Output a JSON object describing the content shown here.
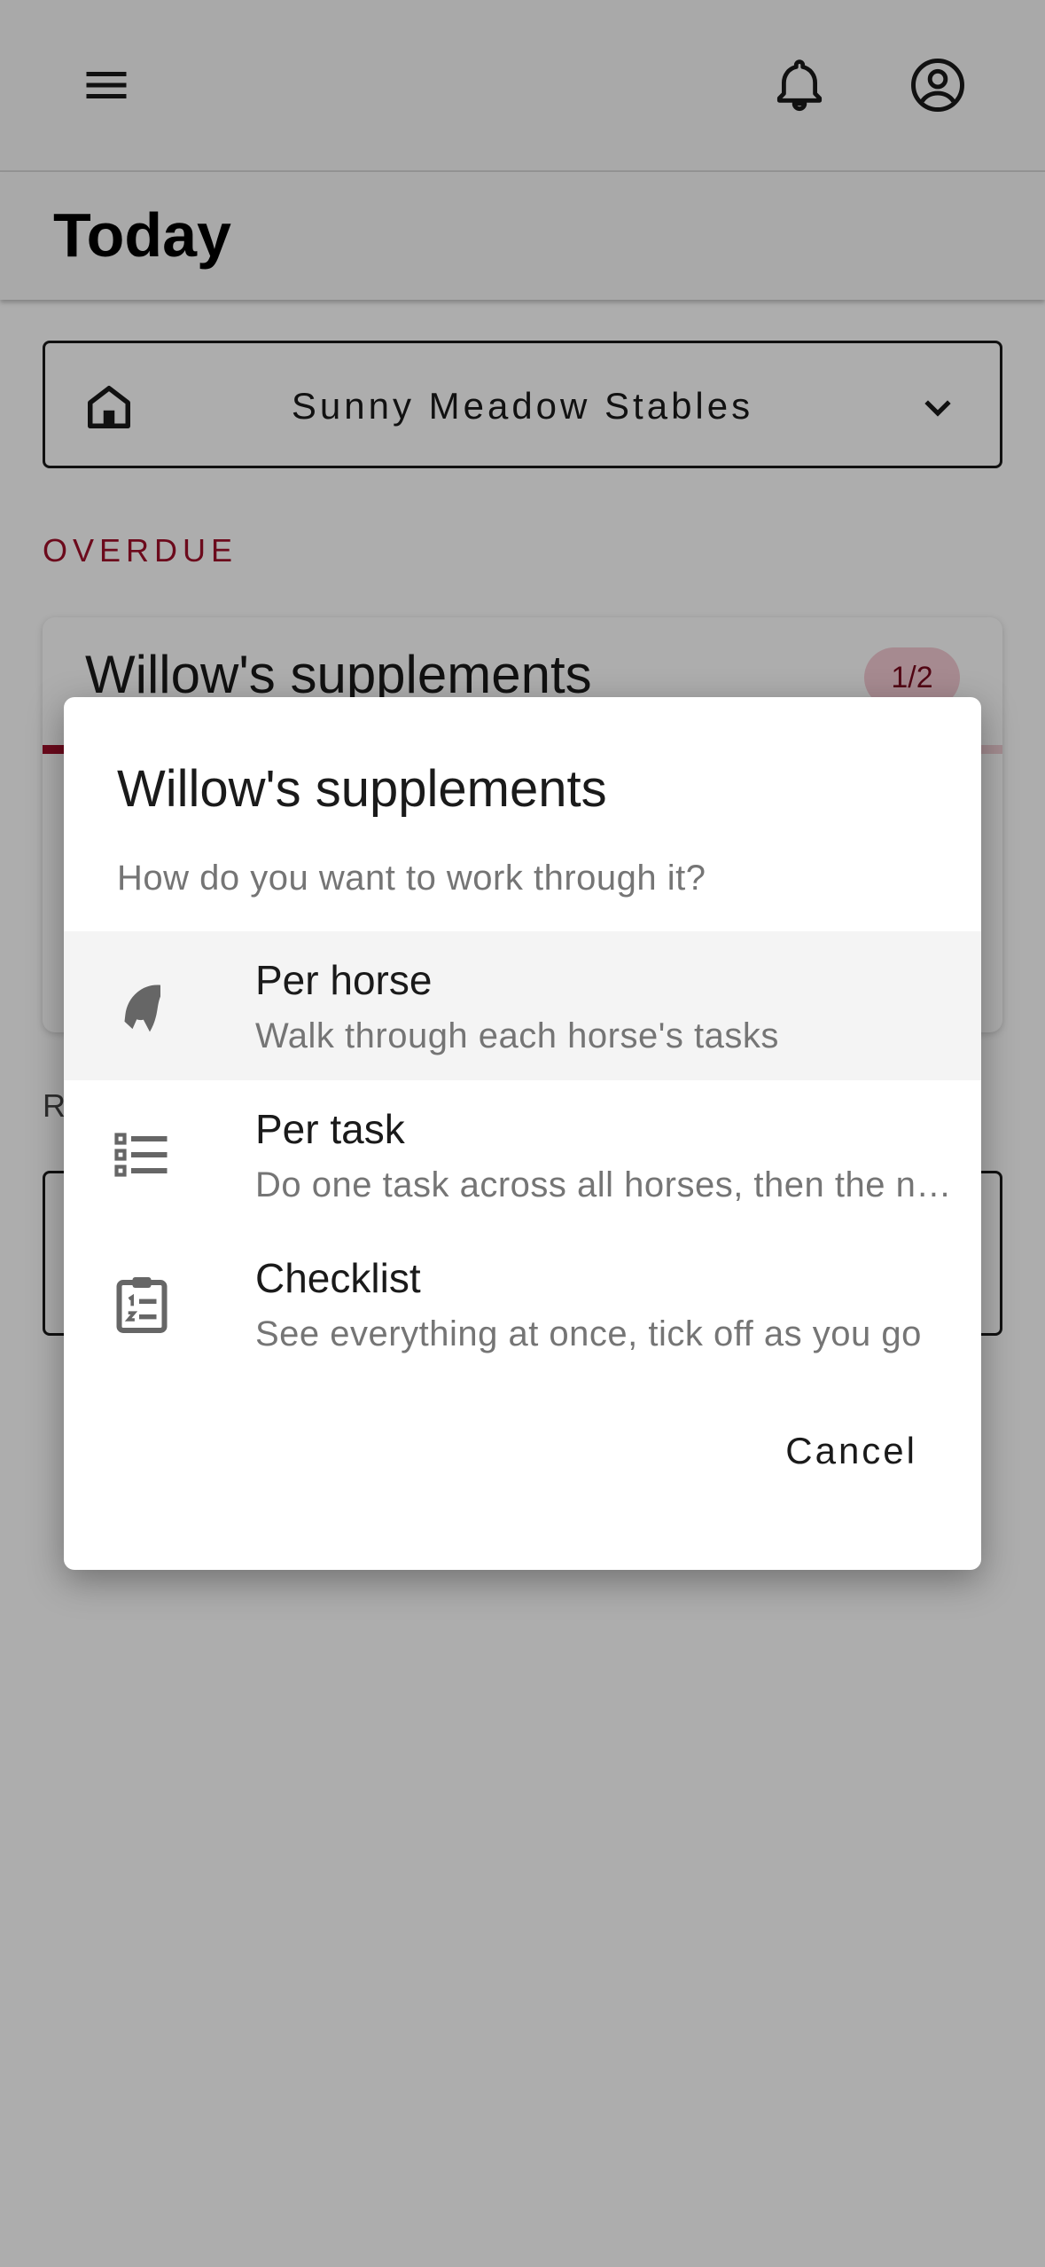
{
  "header": {
    "menu_icon": "menu-icon",
    "notifications_icon": "bell-icon",
    "account_icon": "account-circle-icon"
  },
  "page": {
    "title": "Today"
  },
  "stable_selector": {
    "icon": "home-icon",
    "value": "Sunny Meadow Stables",
    "chevron": "chevron-down-icon"
  },
  "sections": {
    "overdue_label": "OVERDUE",
    "next_label_partial": "R"
  },
  "task_card": {
    "title": "Willow's supplements",
    "badge": "1/2",
    "progress_fraction": 0.5,
    "accent_color": "#a0102a"
  },
  "dialog": {
    "title": "Willow's supplements",
    "subtitle": "How do you want to work through it?",
    "options": [
      {
        "icon": "horse-head-icon",
        "title": "Per horse",
        "description": "Walk through each horse's tasks",
        "selected": true
      },
      {
        "icon": "list-icon",
        "title": "Per task",
        "description": "Do one task across all horses, then the next",
        "selected": false
      },
      {
        "icon": "clipboard-list-icon",
        "title": "Checklist",
        "description": "See everything at once, tick off as you go",
        "selected": false
      }
    ],
    "cancel_label": "Cancel"
  }
}
